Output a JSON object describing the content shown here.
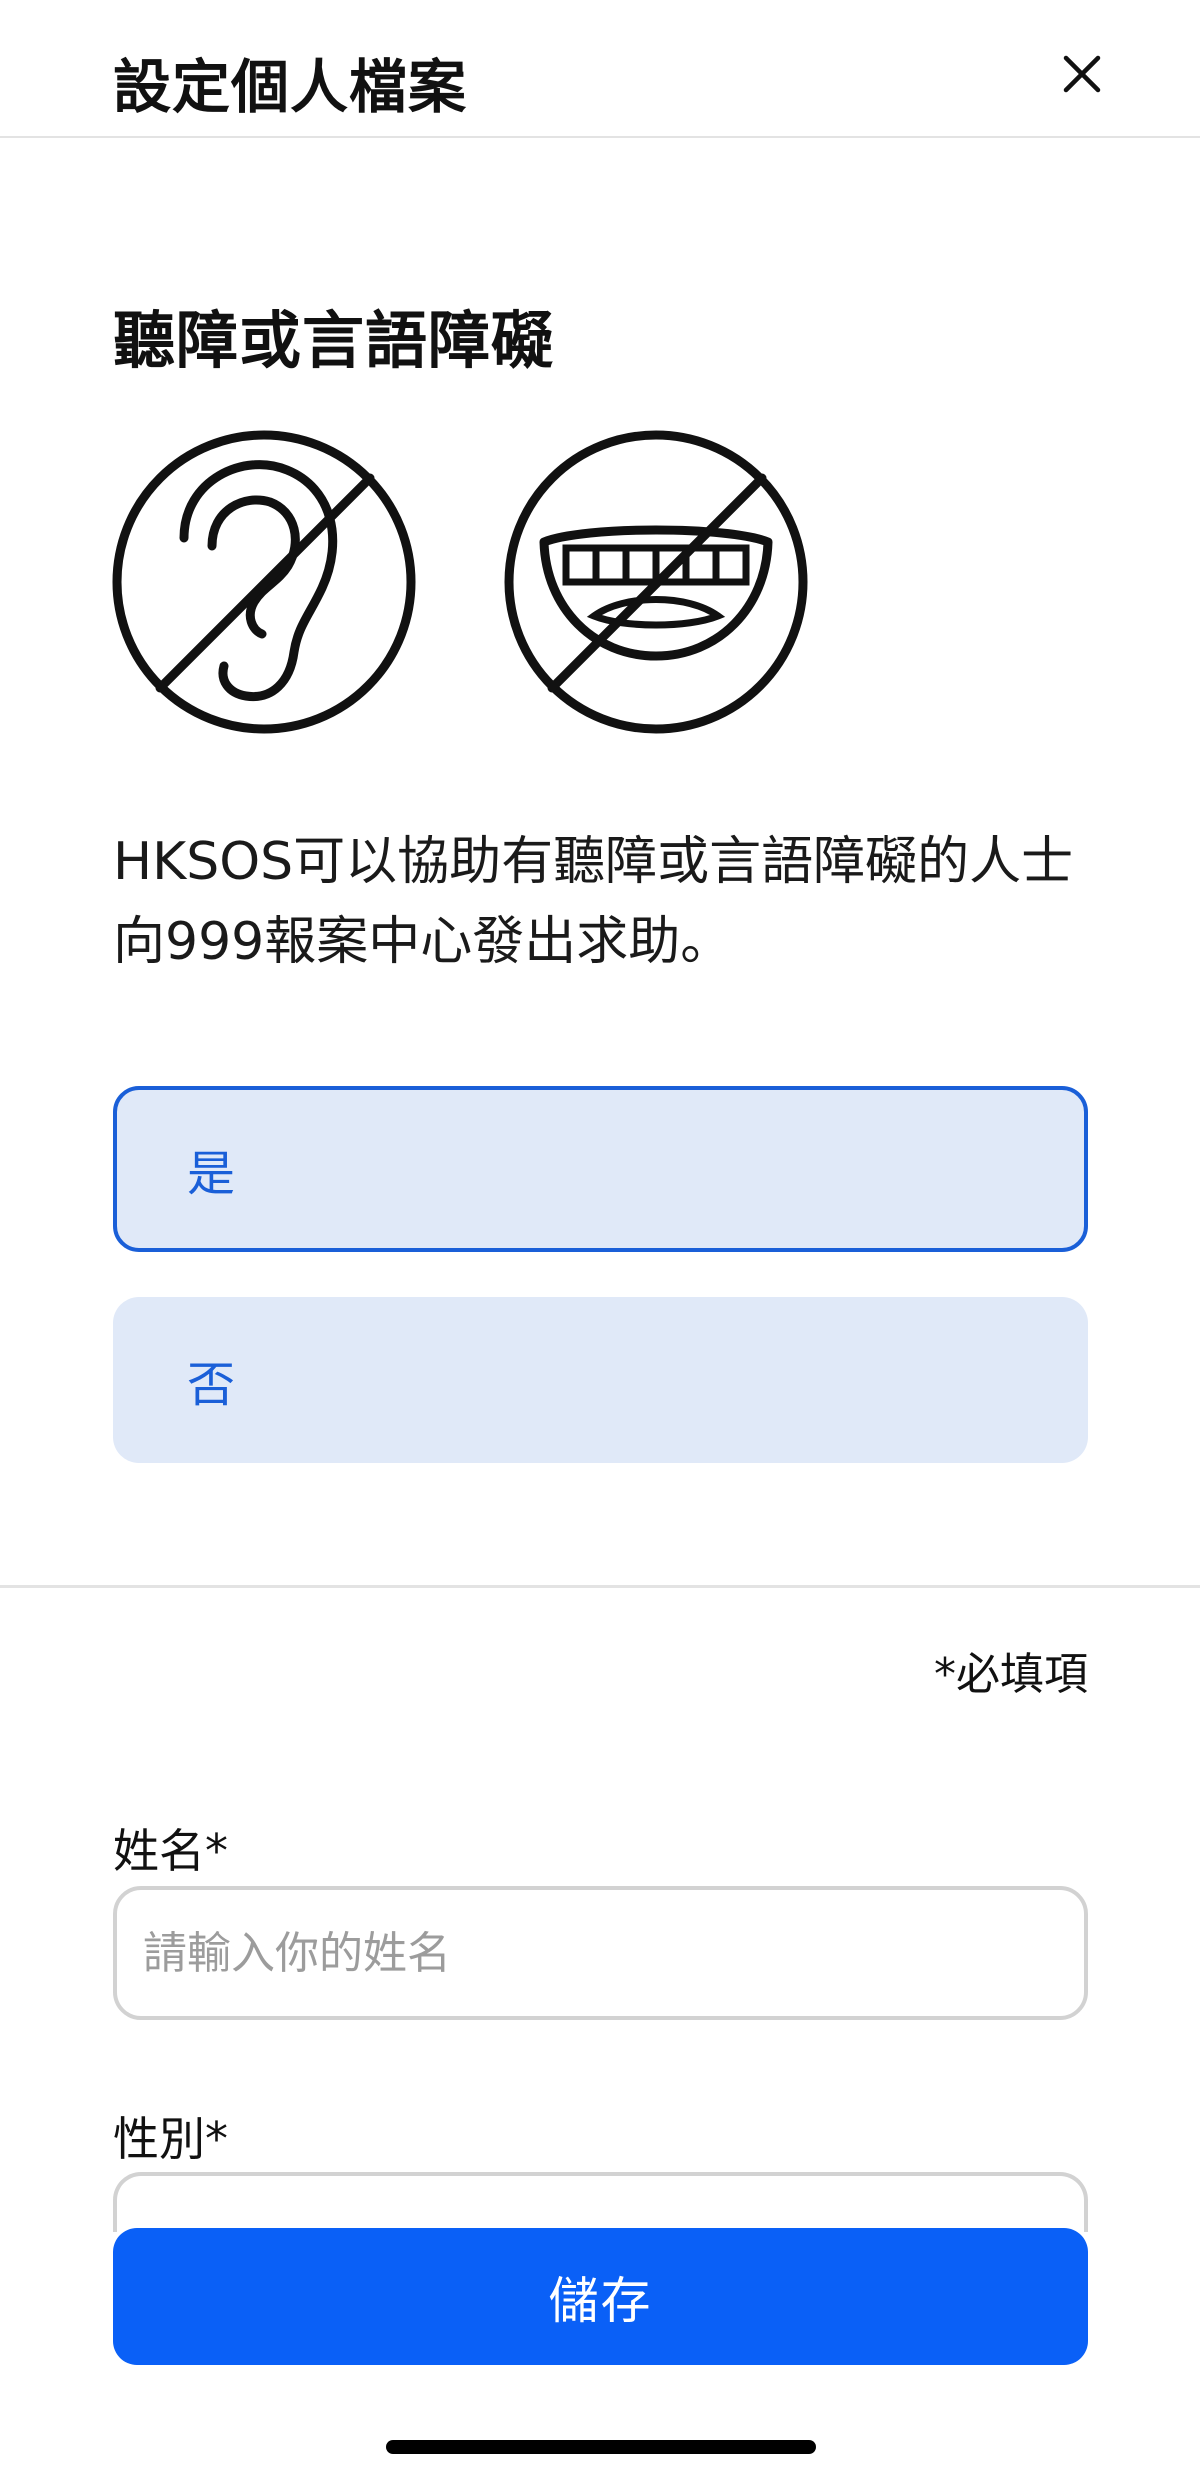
{
  "header": {
    "title": "設定個人檔案",
    "close_icon": "close-icon"
  },
  "section": {
    "title": "聽障或言語障礙",
    "icons": [
      "no-hearing-icon",
      "no-speech-icon"
    ],
    "description": "HKSOS可以協助有聽障或言語障礙的人士向999報案中心發出求助。"
  },
  "options": {
    "yes_label": "是",
    "no_label": "否",
    "selected": "是"
  },
  "form": {
    "required_note": "*必填項",
    "name_label": "姓名*",
    "name_placeholder": "請輸入你的姓名",
    "name_value": "",
    "gender_label": "性別*"
  },
  "footer": {
    "save_label": "儲存"
  },
  "colors": {
    "accent": "#0a60f7",
    "selected_border": "#1a5fd8",
    "option_bg": "#e0e9f8"
  }
}
